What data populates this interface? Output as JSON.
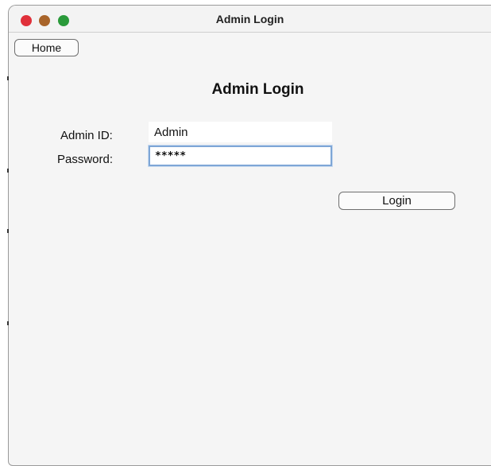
{
  "window": {
    "title": "Admin Login",
    "controls": {
      "close_color": "#e0303a",
      "minimize_color": "#a8642a",
      "maximize_color": "#2a9a3a"
    }
  },
  "nav": {
    "home_label": "Home"
  },
  "form": {
    "heading": "Admin Login",
    "admin_id": {
      "label": "Admin ID:",
      "value": "Admin"
    },
    "password": {
      "label": "Password:",
      "value": "*****"
    },
    "login_label": "Login"
  }
}
